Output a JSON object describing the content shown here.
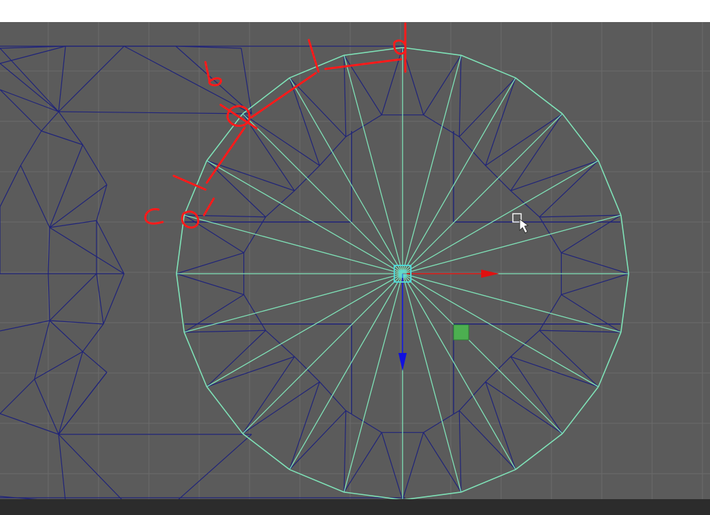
{
  "viewport": {
    "background": "#5b5b5b",
    "grid_color": "#6b6b6b",
    "wire_color": "#1f237a",
    "selection_color": "#7fe3b8",
    "move_x_color": "#e01010",
    "move_y_color": "#1010e0",
    "pivot_color": "#4fd6d6",
    "component_handle_color": "#4caf50"
  },
  "annotations": {
    "color": "#ff1a1a",
    "labels": [
      "a",
      "b",
      "c",
      "d"
    ]
  },
  "cursor_icon": "pointer-with-square-cursor-icon",
  "caption": {
    "text": ""
  }
}
